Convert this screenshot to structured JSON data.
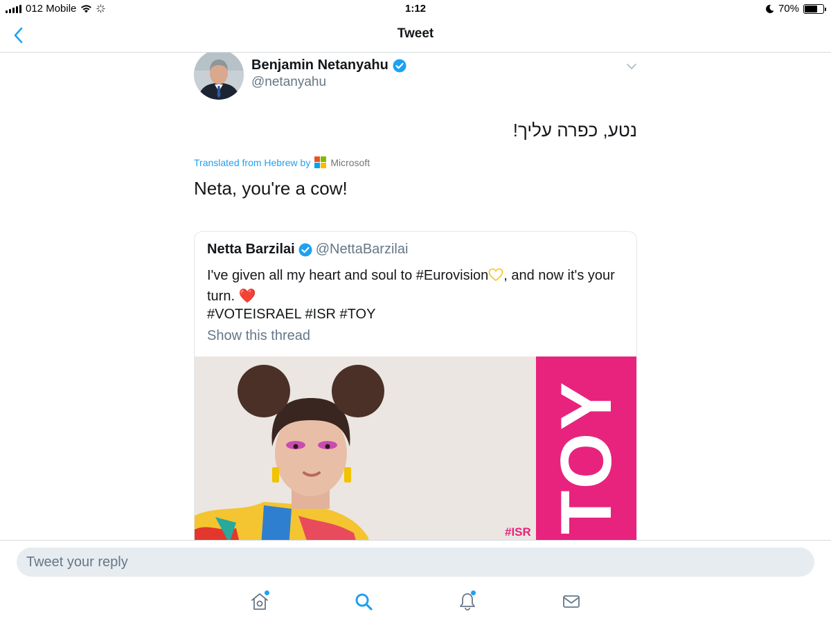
{
  "status_bar": {
    "carrier": "012 Mobile",
    "time": "1:12",
    "battery": "70%",
    "battery_level": 0.7
  },
  "nav": {
    "title": "Tweet"
  },
  "tweet": {
    "author_name": "Benjamin Netanyahu",
    "author_handle": "@netanyahu",
    "text_original": "נטע, כפרה עליך!",
    "translated_label": "Translated from Hebrew by",
    "translator": "Microsoft",
    "text_translated": "Neta, you're a cow!"
  },
  "quoted_tweet": {
    "author_name": "Netta Barzilai",
    "author_handle": "@NettaBarzilai",
    "text_part1": "I've given all my heart and soul to #Eurovision",
    "text_part2": ", and now it's your turn.",
    "heart_emoji": "❤️",
    "hashtags": "#VOTEISRAEL #ISR #TOY",
    "show_thread": "Show this thread",
    "media_banner_text": "TOY",
    "media_tag": "#ISR"
  },
  "reply": {
    "placeholder": "Tweet your reply"
  },
  "colors": {
    "accent": "#1da1f2",
    "secondary_text": "#657786",
    "banner_pink": "#e8237d"
  },
  "icons": {
    "back": "chevron-left-icon",
    "verified": "verified-badge-icon",
    "caret": "chevron-down-icon",
    "home": "home-icon",
    "search": "search-icon",
    "notifications": "bell-icon",
    "messages": "envelope-icon"
  }
}
